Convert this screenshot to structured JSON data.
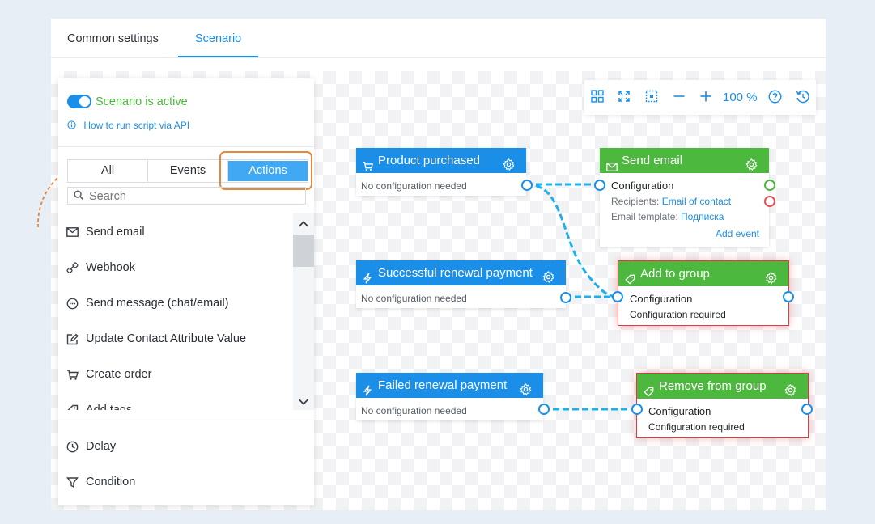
{
  "tabs": [
    "Common settings",
    "Scenario"
  ],
  "panel": {
    "status_label": "Scenario is active",
    "api_link": "How to run script via API",
    "filters": [
      "All",
      "Events",
      "Actions"
    ],
    "search_placeholder": "Search",
    "items": [
      {
        "label": "Send email",
        "icon": "mail-icon"
      },
      {
        "label": "Webhook",
        "icon": "webhook-icon"
      },
      {
        "label": "Send message (chat/email)",
        "icon": "chat-icon"
      },
      {
        "label": "Update Contact Attribute Value",
        "icon": "edit-icon"
      },
      {
        "label": "Create order",
        "icon": "cart-icon"
      },
      {
        "label": "Add tags",
        "icon": "tag-icon"
      }
    ],
    "bottom_items": [
      {
        "label": "Delay",
        "icon": "clock-icon"
      },
      {
        "label": "Condition",
        "icon": "filter-icon"
      }
    ]
  },
  "toolbar": {
    "zoom": "100 %",
    "icons": [
      "grid-icon",
      "fit-screen-icon",
      "crop-icon",
      "zoom-out-icon",
      "zoom-in-icon",
      "help-icon",
      "history-icon"
    ]
  },
  "nodes": {
    "product_purchased": {
      "title": "Product purchased",
      "note": "No configuration needed"
    },
    "renewal_success": {
      "title": "Successful renewal payment",
      "note": "No configuration needed"
    },
    "renewal_failed": {
      "title": "Failed renewal payment",
      "note": "No configuration needed"
    },
    "send_email": {
      "title": "Send email",
      "config": "Configuration",
      "recipients_label": "Recipients:",
      "recipients_value": "Email of contact",
      "template_label": "Email template:",
      "template_value": "Подписка",
      "add_event": "Add event"
    },
    "add_to_group": {
      "title": "Add to group",
      "config": "Configuration",
      "status": "Configuration required"
    },
    "remove_from_group": {
      "title": "Remove from group",
      "config": "Configuration",
      "status": "Configuration required"
    }
  },
  "colors": {
    "accent": "#1b8fe8",
    "action": "#4db83e",
    "error": "#e0393e",
    "highlight": "#e4893c"
  }
}
